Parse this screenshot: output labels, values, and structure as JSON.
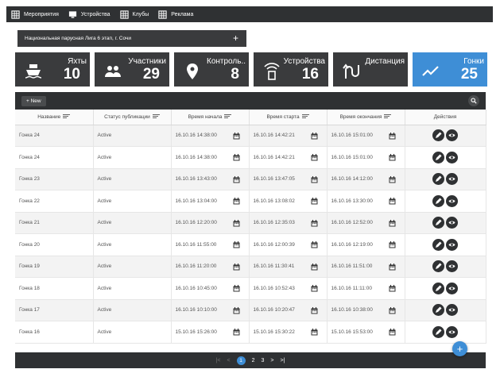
{
  "nav": {
    "items": [
      {
        "label": "Мероприятия",
        "icon": "grid-icon"
      },
      {
        "label": "Устройства",
        "icon": "monitor-icon"
      },
      {
        "label": "Клубы",
        "icon": "grid-icon"
      },
      {
        "label": "Реклама",
        "icon": "grid-icon"
      }
    ]
  },
  "event_select": {
    "value": "Национальная парусная Лига 6 этап, г. Сочи",
    "add_label": "+"
  },
  "stats": [
    {
      "label": "Яхты",
      "value": "10",
      "icon": "ship-icon"
    },
    {
      "label": "Участники",
      "value": "29",
      "icon": "people-icon"
    },
    {
      "label": "Контроль..",
      "value": "8",
      "icon": "location-icon"
    },
    {
      "label": "Устройства",
      "value": "16",
      "icon": "device-signal-icon"
    },
    {
      "label": "Дистанция",
      "value": "",
      "icon": "route-icon"
    },
    {
      "label": "Гонки",
      "value": "25",
      "icon": "chart-line-icon"
    }
  ],
  "toolbar": {
    "new_label": "+ New"
  },
  "table": {
    "headers": [
      "Название",
      "Статус публикации",
      "Время начала",
      "Время старта",
      "Время окончания",
      "Действия"
    ],
    "rows": [
      [
        "Гонка 24",
        "Active",
        "16.10.16 14:38:00",
        "16.10.16 14:42:21",
        "16.10.16 15:01:00"
      ],
      [
        "Гонка 24",
        "Active",
        "16.10.16 14:38:00",
        "16.10.16 14:42:21",
        "16.10.16 15:01:00"
      ],
      [
        "Гонка 23",
        "Active",
        "16.10.16 13:43:00",
        "16.10.16 13:47:05",
        "16.10.16 14:12:00"
      ],
      [
        "Гонка 22",
        "Active",
        "16.10.16 13:04:00",
        "16.10.16 13:08:02",
        "16.10.16 13:30:00"
      ],
      [
        "Гонка 21",
        "Active",
        "16.10.16 12:20:00",
        "16.10.16 12:35:03",
        "16.10.16 12:52:00"
      ],
      [
        "Гонка 20",
        "Active",
        "16.10.16 11:55:00",
        "16.10.16 12:00:39",
        "16.10.16 12:19:00"
      ],
      [
        "Гонка 19",
        "Active",
        "16.10.16 11:20:00",
        "16.10.16 11:30:41",
        "16.10.16 11:51:00"
      ],
      [
        "Гонка 18",
        "Active",
        "16.10.16 10:45:00",
        "16.10.16 10:52:43",
        "16.10.16 11:11:00"
      ],
      [
        "Гонка 17",
        "Active",
        "16.10.16 10:10:00",
        "16.10.16 10:20:47",
        "16.10.16 10:38:00"
      ],
      [
        "Гонка 16",
        "Active",
        "15.10.16 15:26:00",
        "15.10.16 15:30:22",
        "15.10.16 15:53:00"
      ]
    ]
  },
  "pager": {
    "first": "|<",
    "prev": "<",
    "pages": [
      "1",
      "2",
      "3"
    ],
    "next": ">",
    "last": ">|"
  },
  "fab": {
    "label": "+"
  },
  "colors": {
    "dark": "#2f3133",
    "accent": "#3e8ed6"
  }
}
